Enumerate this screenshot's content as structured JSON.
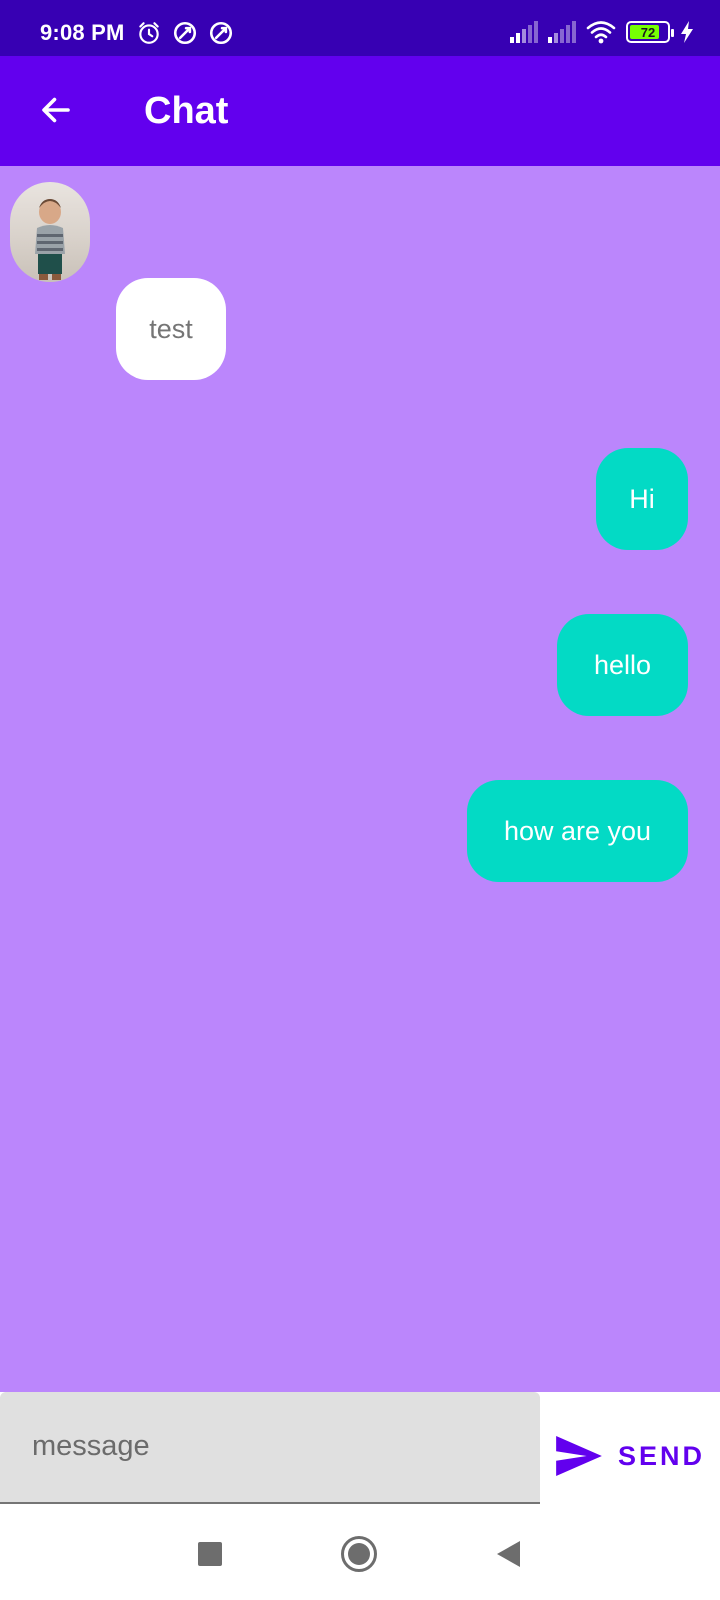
{
  "status_bar": {
    "time": "9:08 PM",
    "battery_level": "72",
    "icons": [
      "alarm-icon",
      "sync-icon",
      "sync-icon",
      "cellular-signal-icon",
      "cellular-signal-icon",
      "wifi-icon",
      "battery-icon",
      "charging-bolt-icon"
    ]
  },
  "app_bar": {
    "back_icon": "arrow-back-icon",
    "title": "Chat"
  },
  "chat": {
    "avatar": "contact-avatar",
    "messages": [
      {
        "text": "test",
        "direction": "received"
      },
      {
        "text": "Hi",
        "direction": "sent"
      },
      {
        "text": "hello",
        "direction": "sent"
      },
      {
        "text": "how are you",
        "direction": "sent"
      }
    ]
  },
  "composer": {
    "placeholder": "message",
    "value": "",
    "send_label": "SEND",
    "send_icon": "send-icon"
  },
  "nav_bar": {
    "icons": [
      "recents-square-icon",
      "home-circle-icon",
      "back-triangle-icon"
    ]
  },
  "colors": {
    "status_bar": "#3700b3",
    "app_bar": "#6200ee",
    "chat_background": "#bb86fc",
    "sent_bubble": "#03dac5",
    "received_bubble": "#ffffff",
    "accent": "#6200ee"
  }
}
